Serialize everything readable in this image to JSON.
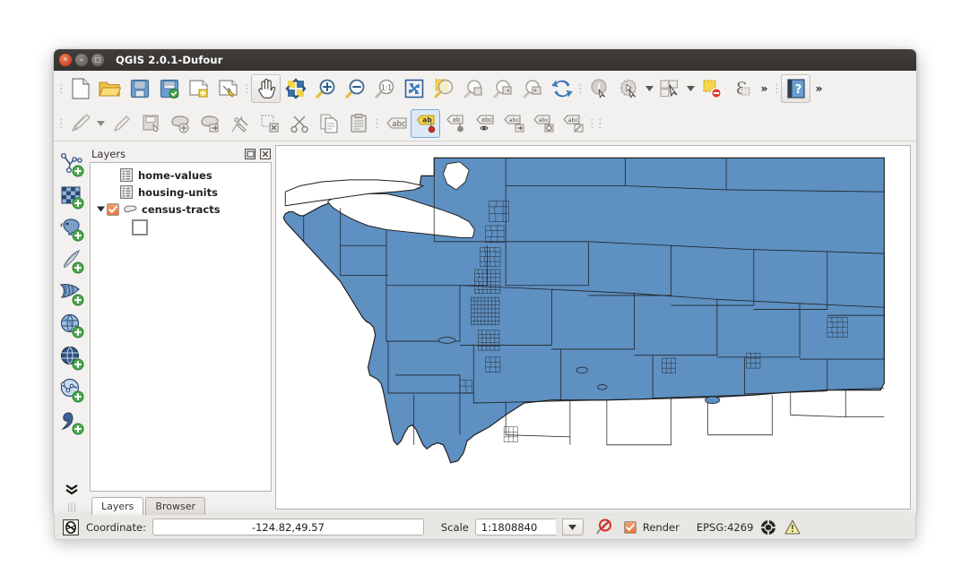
{
  "window": {
    "title": "QGIS 2.0.1-Dufour",
    "controls": [
      {
        "name": "close-button",
        "glyph": "✕"
      },
      {
        "name": "minimize-button",
        "glyph": "–"
      },
      {
        "name": "maximize-button",
        "glyph": "□"
      }
    ]
  },
  "toolbar_row1": [
    {
      "name": "separator",
      "type": "sep"
    },
    {
      "name": "new-project-button",
      "icon": "new-project-icon",
      "label": "New Project"
    },
    {
      "name": "open-project-button",
      "icon": "open-folder-icon",
      "label": "Open Project"
    },
    {
      "name": "save-project-button",
      "icon": "save-icon",
      "label": "Save Project"
    },
    {
      "name": "save-project-as-button",
      "icon": "save-as-icon",
      "label": "Save Project As"
    },
    {
      "name": "new-print-composer-button",
      "icon": "new-composer-icon",
      "label": "New Print Composer"
    },
    {
      "name": "composer-manager-button",
      "icon": "composer-manager-icon",
      "label": "Composer Manager"
    },
    {
      "name": "separator",
      "type": "sep"
    },
    {
      "name": "pan-map-button",
      "icon": "hand-pan-icon",
      "label": "Pan Map",
      "state": "active"
    },
    {
      "name": "pan-to-selection-button",
      "icon": "pan-selection-icon",
      "label": "Pan Map to Selection"
    },
    {
      "name": "zoom-in-button",
      "icon": "zoom-in-icon",
      "label": "Zoom In"
    },
    {
      "name": "zoom-out-button",
      "icon": "zoom-out-icon",
      "label": "Zoom Out"
    },
    {
      "name": "zoom-actual-size-button",
      "icon": "zoom-1to1-icon",
      "label": "Zoom to Native Resolution"
    },
    {
      "name": "zoom-full-button",
      "icon": "zoom-full-icon",
      "label": "Zoom Full"
    },
    {
      "name": "zoom-to-selection-button",
      "icon": "zoom-selection-icon",
      "label": "Zoom to Selection"
    },
    {
      "name": "zoom-to-layer-button",
      "icon": "zoom-layer-icon",
      "label": "Zoom to Layer"
    },
    {
      "name": "zoom-last-button",
      "icon": "zoom-last-icon",
      "label": "Zoom Last"
    },
    {
      "name": "zoom-next-button",
      "icon": "zoom-next-icon",
      "label": "Zoom Next"
    },
    {
      "name": "refresh-button",
      "icon": "refresh-icon",
      "label": "Refresh"
    },
    {
      "name": "separator",
      "type": "sep"
    },
    {
      "name": "identify-features-button",
      "icon": "identify-icon",
      "label": "Identify Features"
    },
    {
      "name": "run-feature-action-button",
      "icon": "feature-action-icon",
      "label": "Run Feature Action"
    },
    {
      "name": "feature-action-dropdown",
      "type": "arrow",
      "icon": "chevron-down-icon"
    },
    {
      "name": "select-features-button",
      "icon": "select-features-icon",
      "label": "Select Features"
    },
    {
      "name": "select-dropdown",
      "type": "arrow",
      "icon": "chevron-down-icon"
    },
    {
      "name": "deselect-features-button",
      "icon": "deselect-icon",
      "label": "Deselect Features"
    },
    {
      "name": "open-field-calculator-button",
      "icon": "field-calculator-icon",
      "label": "Open Field Calculator"
    },
    {
      "name": "toolbar-overflow-button",
      "type": "chev",
      "icon": "double-chevron-right-icon"
    },
    {
      "name": "separator",
      "type": "sep"
    },
    {
      "name": "help-button",
      "icon": "help-book-icon",
      "label": "Help"
    },
    {
      "name": "toolbar-overflow-button-2",
      "type": "chev",
      "icon": "double-chevron-right-icon"
    }
  ],
  "toolbar_row2": [
    {
      "name": "separator",
      "type": "sep"
    },
    {
      "name": "toggle-editing-button",
      "icon": "toggle-editing-icon",
      "label": "Toggle Editing"
    },
    {
      "name": "toggle-editing-dropdown",
      "type": "arrow",
      "icon": "chevron-down-icon"
    },
    {
      "name": "current-edits-button",
      "icon": "pencil-icon",
      "label": "Current Edits"
    },
    {
      "name": "save-layer-edits-button",
      "icon": "save-edits-icon",
      "label": "Save Layer Edits"
    },
    {
      "name": "add-feature-button",
      "icon": "add-feature-icon",
      "label": "Add Feature"
    },
    {
      "name": "move-feature-button",
      "icon": "move-feature-icon",
      "label": "Move Feature"
    },
    {
      "name": "node-tool-button",
      "icon": "node-tool-icon",
      "label": "Node Tool"
    },
    {
      "name": "delete-selected-button",
      "icon": "delete-selected-icon",
      "label": "Delete Selected"
    },
    {
      "name": "cut-features-button",
      "icon": "scissors-icon",
      "label": "Cut Features"
    },
    {
      "name": "copy-features-button",
      "icon": "copy-icon",
      "label": "Copy Features"
    },
    {
      "name": "paste-features-button",
      "icon": "paste-icon",
      "label": "Paste Features"
    },
    {
      "name": "separator",
      "type": "sep"
    },
    {
      "name": "layer-labeling-button",
      "icon": "label-abc-icon",
      "label": "Layer Labeling Options"
    },
    {
      "name": "pin-labels-button",
      "icon": "label-pin-icon",
      "label": "Pin/Unpin Labels",
      "state": "checked"
    },
    {
      "name": "show-hide-labels-button",
      "icon": "label-show-icon",
      "label": "Show/Hide Labels"
    },
    {
      "name": "highlight-pinned-labels-button",
      "icon": "label-eye-icon",
      "label": "Highlight Pinned Labels"
    },
    {
      "name": "move-label-button",
      "icon": "label-move-icon",
      "label": "Move Label"
    },
    {
      "name": "rotate-label-button",
      "icon": "label-rotate-icon",
      "label": "Rotate Label"
    },
    {
      "name": "change-label-button",
      "icon": "label-change-icon",
      "label": "Change Label"
    },
    {
      "name": "separator",
      "type": "sep"
    },
    {
      "name": "separator",
      "type": "sep"
    }
  ],
  "left_toolbar": [
    {
      "name": "add-vector-layer-button",
      "icon": "add-vector-layer-icon",
      "label": "Add Vector Layer"
    },
    {
      "name": "add-raster-layer-button",
      "icon": "add-raster-layer-icon",
      "label": "Add Raster Layer"
    },
    {
      "name": "add-postgis-layer-button",
      "icon": "add-postgis-layer-icon",
      "label": "Add PostGIS Layer"
    },
    {
      "name": "add-spatialite-layer-button",
      "icon": "add-spatialite-layer-icon",
      "label": "Add SpatiaLite Layer"
    },
    {
      "name": "add-mssql-layer-button",
      "icon": "add-mssql-layer-icon",
      "label": "Add MSSQL Spatial Layer"
    },
    {
      "name": "add-wms-layer-button",
      "icon": "add-wms-layer-icon",
      "label": "Add WMS/WMTS Layer"
    },
    {
      "name": "add-wcs-layer-button",
      "icon": "add-wcs-layer-icon",
      "label": "Add WCS Layer"
    },
    {
      "name": "add-wfs-layer-button",
      "icon": "add-wfs-layer-icon",
      "label": "Add WFS Layer"
    },
    {
      "name": "add-delimited-text-layer-button",
      "icon": "add-delimited-text-icon",
      "label": "Add Delimited Text Layer"
    }
  ],
  "left_toolbar_overflow": {
    "name": "left-toolbar-overflow-button",
    "icon": "double-chevron-down-icon",
    "glyph": "»"
  },
  "layers_panel": {
    "title": "Layers",
    "float_icon": "float-dock-icon",
    "close_icon": "close-dock-icon",
    "items": [
      {
        "name": "home-values",
        "label": "home-values",
        "icon": "table-layer-icon",
        "checked": false,
        "expandable": false,
        "indent": 1
      },
      {
        "name": "housing-units",
        "label": "housing-units",
        "icon": "table-layer-icon",
        "checked": false,
        "expandable": false,
        "indent": 1
      },
      {
        "name": "census-tracts",
        "label": "census-tracts",
        "icon": "polygon-layer-icon",
        "checked": true,
        "expandable": true,
        "indent": 0
      }
    ],
    "symbol": {
      "name": "census-tracts-symbol",
      "fill": "#5e90c2",
      "stroke": "#8e8a85"
    },
    "tabs": [
      {
        "name": "tab-layers",
        "label": "Layers",
        "selected": true
      },
      {
        "name": "tab-browser",
        "label": "Browser",
        "selected": false
      }
    ]
  },
  "map": {
    "name": "map-canvas",
    "background": "#ffffff",
    "fill": "#5e90c2",
    "stroke": "#1d1d1d"
  },
  "statusbar": {
    "message_icon": "messages-icon",
    "coordinate_label": "Coordinate:",
    "coordinate_value": "-124.82,49.57",
    "coordinate_placeholder": "-124.82,49.57",
    "scale_label": "Scale",
    "scale_value": "1:1808840",
    "scale_dropdown_icon": "chevron-down-icon",
    "stop_render_icon": "stop-render-icon",
    "render_label": "Render",
    "render_checked": true,
    "crs_label": "EPSG:4269",
    "crs_icon": "crs-globe-icon",
    "messages_warning_icon": "warning-icon"
  }
}
